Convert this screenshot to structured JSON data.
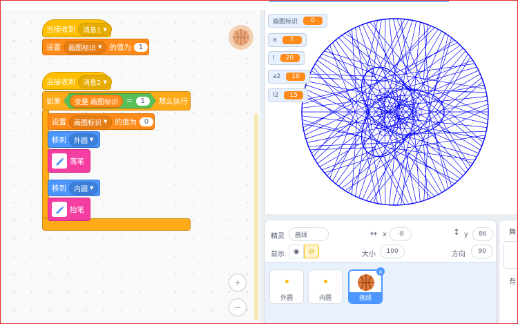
{
  "events": [
    {
      "label": "当接收到",
      "message": "消息1"
    },
    {
      "label": "当接收到",
      "message": "消息2"
    }
  ],
  "set_block_1": {
    "label": "设置",
    "variable": "画图标识",
    "suffix": "的值为",
    "value": "1"
  },
  "if_block": {
    "label": "如果",
    "then": "那么执行",
    "var_prefix": "变量",
    "var_name": "画图标识",
    "op": "=",
    "value": "1"
  },
  "set_block_2": {
    "label": "设置",
    "variable": "画图标识",
    "suffix": "的值为",
    "value": "0"
  },
  "goto_1": {
    "label": "移到",
    "target": "外圆"
  },
  "pen_down": {
    "label": "落笔"
  },
  "goto_2": {
    "label": "移到",
    "target": "内圆"
  },
  "pen_up": {
    "label": "抬笔"
  },
  "zoom": {
    "in": "+",
    "out": "−"
  },
  "monitors": [
    {
      "name": "画图标识",
      "value": "0"
    },
    {
      "name": "a",
      "value": "7"
    },
    {
      "name": "l",
      "value": "20"
    },
    {
      "name": "a2",
      "value": "10"
    },
    {
      "name": "l2",
      "value": "15"
    }
  ],
  "sprite_info": {
    "sprite_label": "精灵",
    "sprite_name": "画线",
    "x_label": "x",
    "x_value": "-8",
    "y_label": "y",
    "y_value": "86",
    "show_label": "显示",
    "size_label": "大小",
    "size_value": "100",
    "direction_label": "方向",
    "direction_value": "90"
  },
  "sprites": [
    {
      "name": "外圆"
    },
    {
      "name": "内圆"
    },
    {
      "name": "画线"
    }
  ],
  "right_panel": {
    "stage_label": "舞",
    "backdrop_label": "背"
  },
  "colors": {
    "pattern": "#0000ff",
    "accent": "#4c97ff",
    "pen": "#f53ea2"
  }
}
